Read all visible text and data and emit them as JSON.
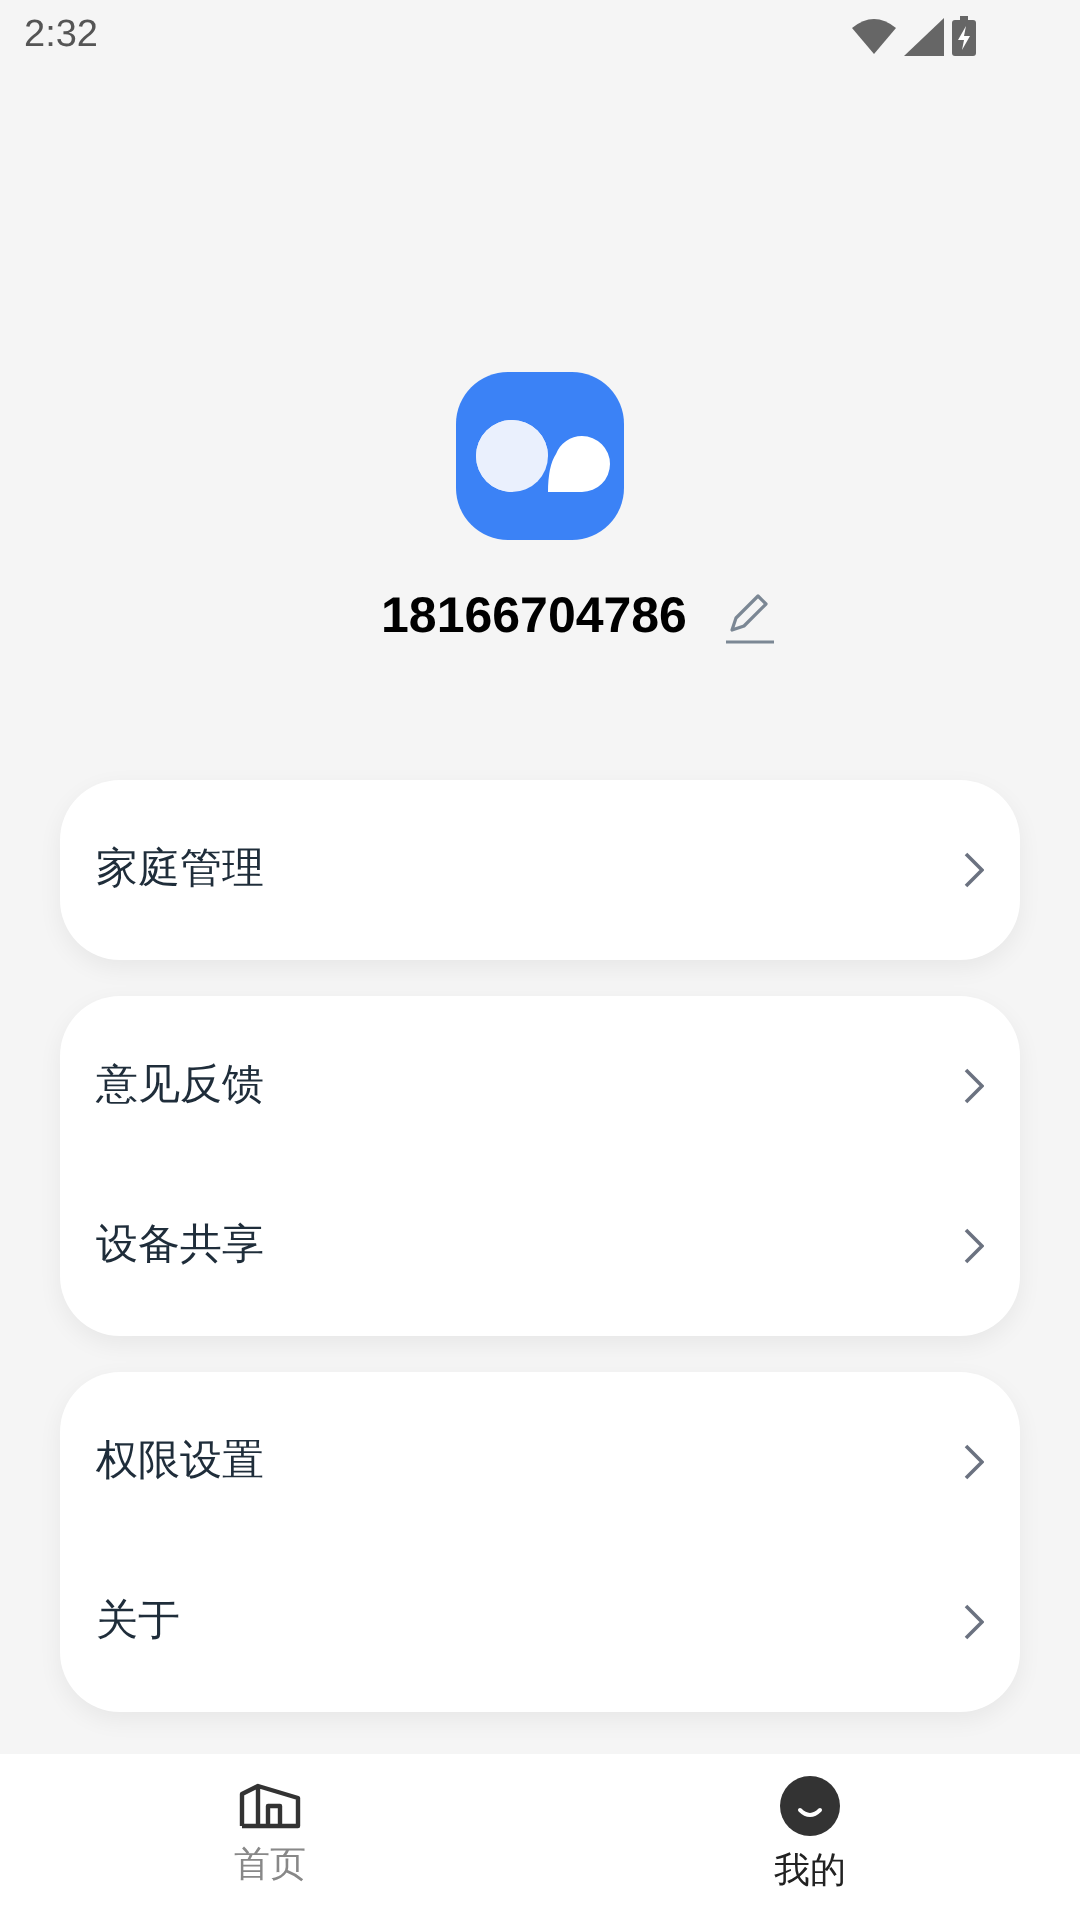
{
  "status_bar": {
    "time": "2:32"
  },
  "profile": {
    "name": "18166704786"
  },
  "groups": [
    {
      "items": [
        {
          "label": "家庭管理"
        }
      ]
    },
    {
      "items": [
        {
          "label": "意见反馈"
        },
        {
          "label": "设备共享"
        }
      ]
    },
    {
      "items": [
        {
          "label": "权限设置"
        },
        {
          "label": "关于"
        }
      ]
    }
  ],
  "tab_bar": [
    {
      "label": "首页",
      "kind": "home",
      "selected": false
    },
    {
      "label": "我的",
      "kind": "me",
      "selected": true
    }
  ]
}
